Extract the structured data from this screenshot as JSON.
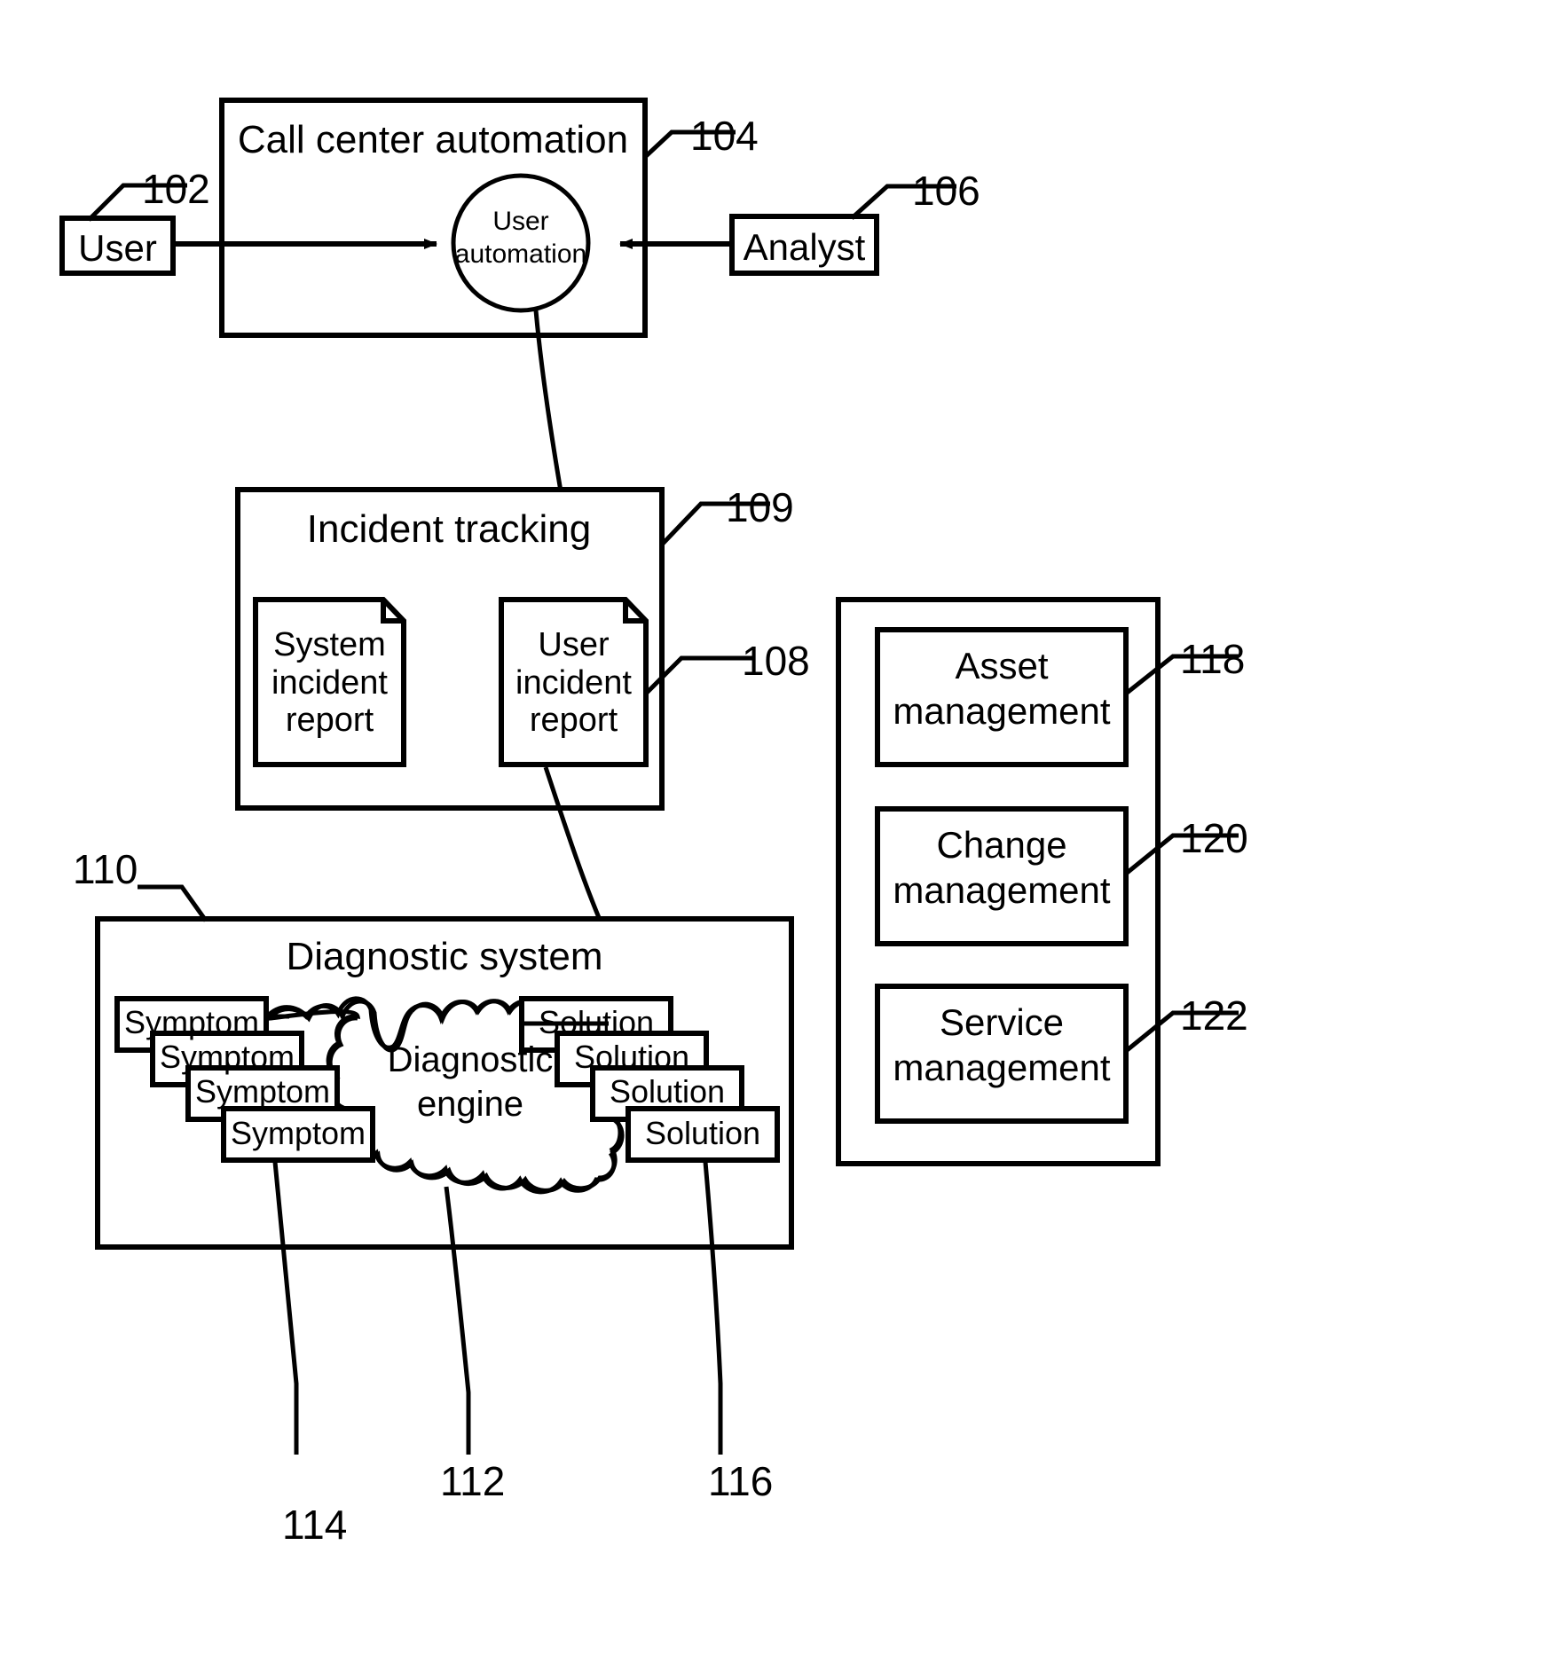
{
  "figure": {
    "type": "patent-block-diagram",
    "background_color": "#ffffff",
    "line_color": "#000000"
  },
  "blocks": {
    "call_center": {
      "title": "Call center automation",
      "ref": "104"
    },
    "user": {
      "label": "User",
      "ref": "102"
    },
    "analyst": {
      "label": "Analyst",
      "ref": "106"
    },
    "user_automation": {
      "label": "User\nautomation"
    },
    "incident_tracking": {
      "title": "Incident tracking",
      "ref": "109"
    },
    "system_incident_report": {
      "label": "System\nincident\nreport"
    },
    "user_incident_report": {
      "label": "User\nincident\nreport",
      "ref": "108"
    },
    "diagnostic_system": {
      "title": "Diagnostic system",
      "ref": "110"
    },
    "diagnostic_engine": {
      "label": "Diagnostic\nengine",
      "ref": "112"
    },
    "symptoms": {
      "label": "Symptom",
      "ref": "114",
      "items": [
        "Symptom",
        "Symptom",
        "Symptom",
        "Symptom"
      ]
    },
    "solutions": {
      "label": "Solution",
      "ref": "116",
      "items": [
        "Solution",
        "Solution",
        "Solution",
        "Solution"
      ]
    },
    "management_panel": {
      "items": [
        {
          "label": "Asset\nmanagement",
          "ref": "118"
        },
        {
          "label": "Change\nmanagement",
          "ref": "120"
        },
        {
          "label": "Service\nmanagement",
          "ref": "122"
        }
      ]
    }
  },
  "reference_numerals": {
    "n102": "102",
    "n104": "104",
    "n106": "106",
    "n108": "108",
    "n109": "109",
    "n110": "110",
    "n112": "112",
    "n114": "114",
    "n116": "116",
    "n118": "118",
    "n120": "120",
    "n122": "122"
  },
  "text": {
    "call_center_title": "Call center automation",
    "user": "User",
    "analyst": "Analyst",
    "user_automation_line1": "User",
    "user_automation_line2": "automation",
    "incident_tracking_title": "Incident tracking",
    "system_incident_report": "System\nincident\nreport",
    "user_incident_report": "User\nincident\nreport",
    "diagnostic_system_title": "Diagnostic system",
    "diagnostic_engine": "Diagnostic\nengine",
    "symptom": "Symptom",
    "solution": "Solution",
    "asset_management": "Asset\nmanagement",
    "change_management": "Change\nmanagement",
    "service_management": "Service\nmanagement"
  }
}
